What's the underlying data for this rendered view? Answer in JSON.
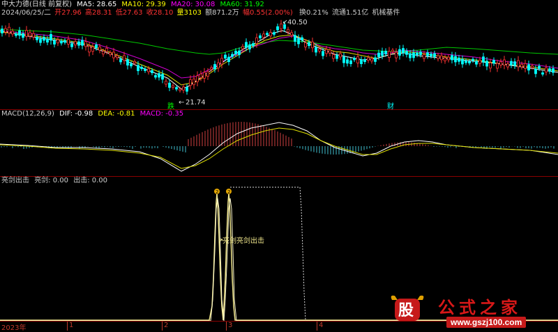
{
  "header": {
    "title": "中大力德(日线 前复权)",
    "ma5": "MA5: 28.65",
    "ma10": "MA10: 29.39",
    "ma20": "MA20: 30.08",
    "ma60": "MA60: 31.92",
    "date": "2024/06/25/二",
    "open": "开27.96",
    "high": "高28.31",
    "low": "低27.63",
    "close": "收28.10",
    "volume": "量3103",
    "amount": "额871.2万",
    "change": "幅0.55(2.00%)",
    "turnover": "换0.21%",
    "float": "流通1.51亿",
    "sector": "机械基件",
    "colors": {
      "ma5": "#ffffff",
      "ma10": "#ffff00",
      "ma20": "#ff00ff",
      "ma60": "#00ff00",
      "up": "#ff3232",
      "down": "#00ffff"
    }
  },
  "price_panel": {
    "high_marker": "40.50",
    "low_marker": "21.74",
    "event_left": "跌",
    "event_right": "财"
  },
  "macd_panel": {
    "label": "MACD(12,26,9)",
    "dif": "DIF: -0.98",
    "dea": "DEA: -0.81",
    "macd": "MACD: -0.35"
  },
  "signal_panel": {
    "label": "亮剑出击",
    "val1": "亮剑: 0.00",
    "val2": "出击: 0.00",
    "annotation": "亮剑亮剑出击",
    "peak_markers": [
      "2",
      "2"
    ]
  },
  "x_axis": {
    "labels": [
      "2023年",
      "1",
      "2",
      "3",
      "4"
    ]
  },
  "watermark": {
    "stamp": "股",
    "text": "公式之家",
    "url": "www.gszj100.com"
  }
}
